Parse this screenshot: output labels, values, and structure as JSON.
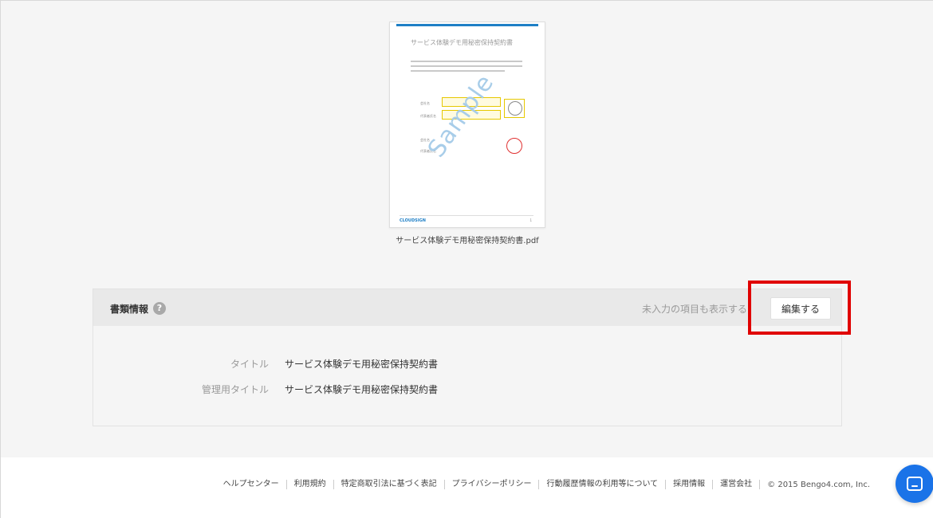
{
  "preview": {
    "doc_title": "サービス体験デモ用秘密保持契約書",
    "watermark": "Sample",
    "field_labels": [
      "会社名",
      "代表者氏名",
      "会社名",
      "代表者氏名"
    ],
    "logo": "CLOUDSIGN",
    "page_number": "1",
    "filename": "サービス体験デモ用秘密保持契約書.pdf"
  },
  "info_panel": {
    "title": "書類情報",
    "help_icon": "?",
    "show_empty_label": "未入力の項目も表示する",
    "edit_button_label": "編集する",
    "rows": [
      {
        "label": "タイトル",
        "value": "サービス体験デモ用秘密保持契約書"
      },
      {
        "label": "管理用タイトル",
        "value": "サービス体験デモ用秘密保持契約書"
      }
    ]
  },
  "footer": {
    "links": [
      "ヘルプセンター",
      "利用規約",
      "特定商取引法に基づく表記",
      "プライバシーポリシー",
      "行動履歴情報の利用等について",
      "採用情報",
      "運営会社"
    ],
    "copyright": "© 2015 Bengo4.com, Inc."
  },
  "chat": {
    "icon": "chat-bubble-icon"
  },
  "colors": {
    "highlight": "#e00000",
    "accent": "#1a73e8",
    "pdf_bar": "#1e7fc6"
  }
}
